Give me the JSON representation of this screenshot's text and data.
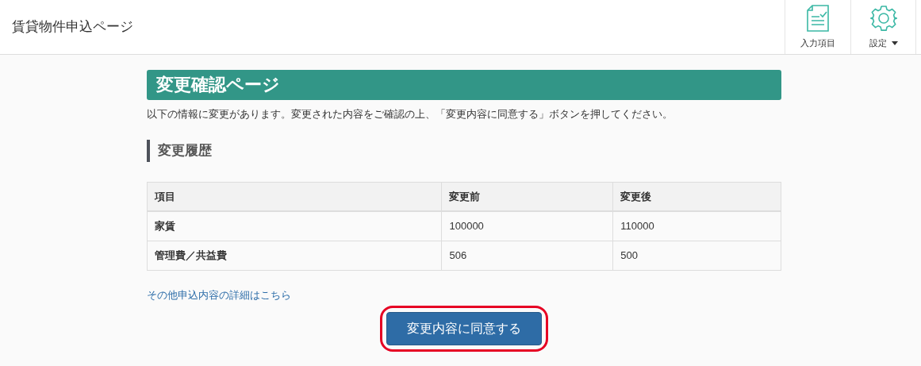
{
  "header": {
    "title": "賃貸物件申込ページ",
    "actions": [
      {
        "kind": "form",
        "label": "入力項目",
        "dropdown": false
      },
      {
        "kind": "settings",
        "label": "設定",
        "dropdown": true
      }
    ]
  },
  "page_title": "変更確認ページ",
  "description": "以下の情報に変更があります。変更された内容をご確認の上、「変更内容に同意する」ボタンを押してください。",
  "section_heading": "変更履歴",
  "table": {
    "columns": [
      "項目",
      "変更前",
      "変更後"
    ],
    "rows": [
      [
        "家賃",
        "100000",
        "110000"
      ],
      [
        "管理費／共益費",
        "506",
        "500"
      ]
    ]
  },
  "details_link": "その他申込内容の詳細はこちら",
  "agree_button": {
    "label": "変更内容に同意する",
    "highlighted": true
  }
}
